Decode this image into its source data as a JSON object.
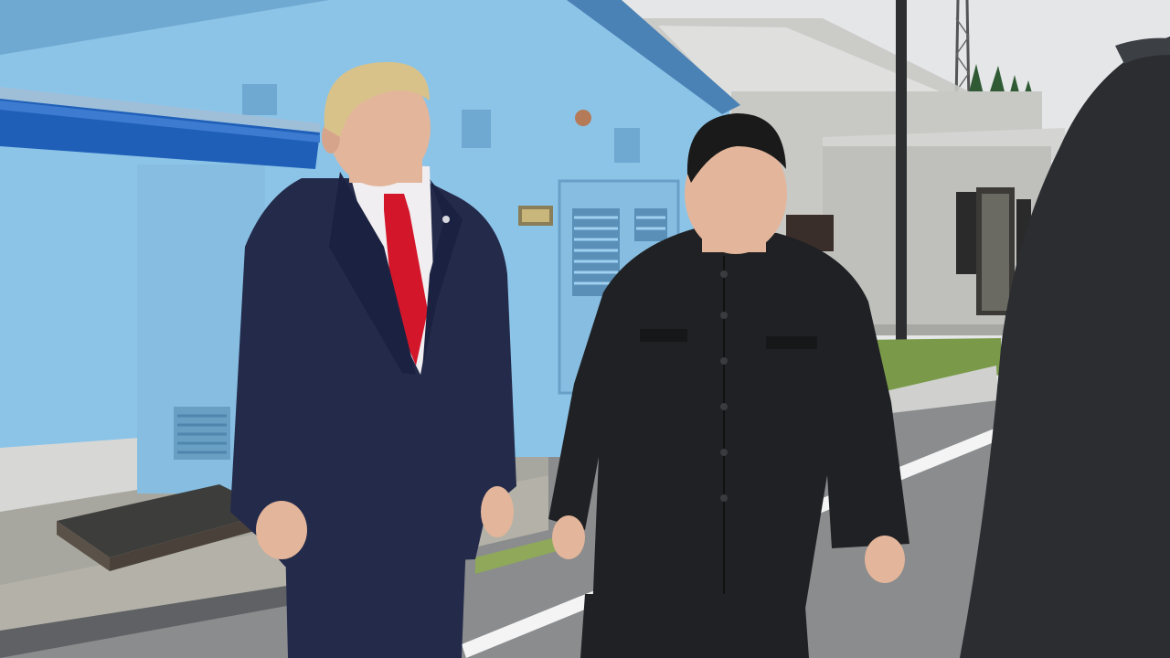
{
  "scene": {
    "palette": {
      "sky": "#e4e6e8",
      "building_blue": "#8cc4e8",
      "building_blue_shadow": "#6fa8d0",
      "awning": "#1f5fb8",
      "grey_building": "#c8c8c4",
      "road": "#8a8c8e",
      "road_line": "#f4f4f4",
      "grass": "#7a9a4a",
      "trees": "#2f5a34",
      "suit_navy": "#232a4a",
      "tie_red": "#d3162a",
      "suit_black": "#202124",
      "skin": "#e3b59a",
      "hair_blond": "#d8c28a",
      "hair_black": "#1a1a1a",
      "foreground_figure": "#2b2d31"
    },
    "elements": [
      "blue-building",
      "blue-awning",
      "louvered-door",
      "grey-building",
      "street-lamp-pole",
      "radio-tower",
      "trees",
      "road",
      "grass-strip",
      "man-in-navy-suit",
      "man-in-black-tunic-suit",
      "foreground-shoulder"
    ]
  }
}
